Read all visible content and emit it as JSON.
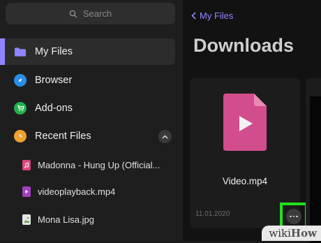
{
  "sidebar": {
    "search_placeholder": "Search",
    "nav": [
      {
        "label": "My Files",
        "icon": "folder-icon",
        "color": "#8f86ff"
      },
      {
        "label": "Browser",
        "icon": "compass-icon",
        "color": "#2b8ee6"
      },
      {
        "label": "Add-ons",
        "icon": "cart-icon",
        "color": "#22b14c"
      },
      {
        "label": "Recent Files",
        "icon": "clock-icon",
        "color": "#f0a030"
      }
    ],
    "recent": [
      {
        "label": "Madonna - Hung Up (Official...",
        "icon": "audio-file-icon",
        "color": "#d9467f"
      },
      {
        "label": "videoplayback.mp4",
        "icon": "video-file-icon",
        "color": "#a040c0"
      },
      {
        "label": "Mona Lisa.jpg",
        "icon": "image-file-icon",
        "color": "#66a84a"
      }
    ]
  },
  "main": {
    "back_label": "My Files",
    "title": "Downloads",
    "files": [
      {
        "name": "Video.mp4",
        "date": "11.01.2020",
        "color": "#d24d8e"
      }
    ]
  },
  "watermark": {
    "part1": "wiki",
    "part2": "How"
  },
  "colors": {
    "accent": "#8f86ff",
    "highlight": "#22e11c"
  }
}
